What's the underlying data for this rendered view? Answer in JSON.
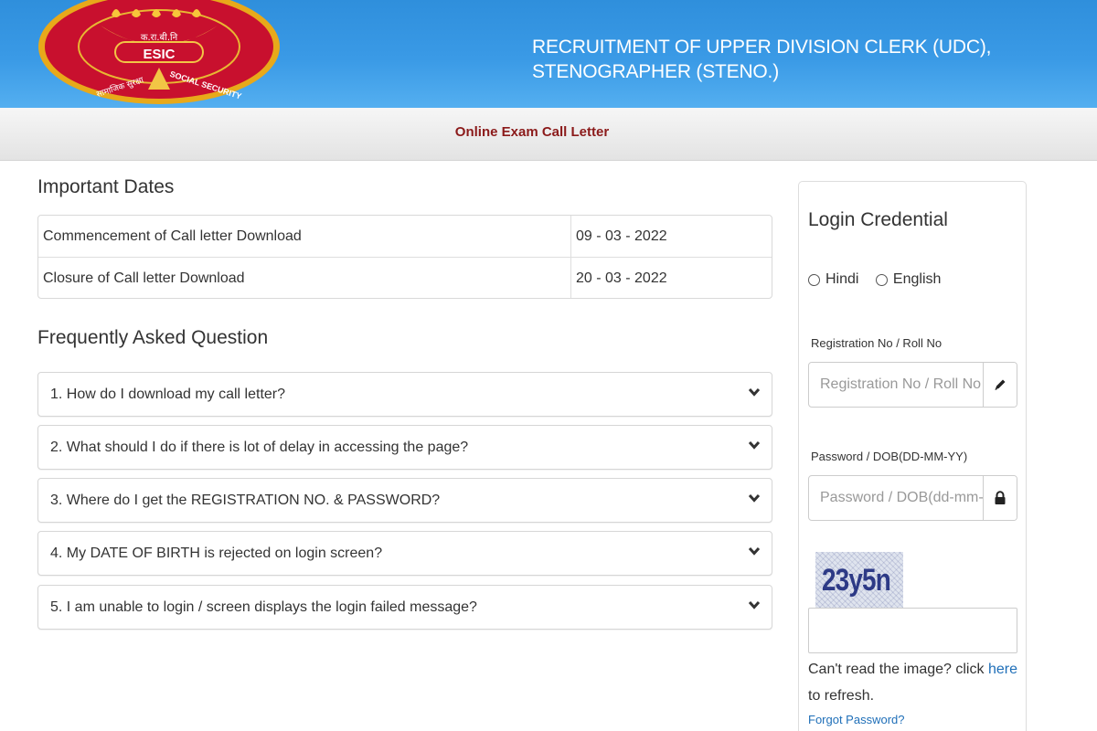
{
  "header": {
    "logo_text": "ESIC",
    "logo_devanagari": "क.रा.बी.नि",
    "logo_motto_left": "सामाजिक सुरक्षा",
    "logo_motto_right": "SOCIAL SECURITY",
    "title_line1": "RECRUITMENT OF UPPER DIVISION CLERK (UDC),",
    "title_line2": "STENOGRAPHER (STENO.)"
  },
  "subbar": {
    "title": "Online Exam Call Letter"
  },
  "important_dates": {
    "heading": "Important Dates",
    "rows": [
      {
        "label": "Commencement of Call letter Download",
        "value": "09 - 03 - 2022"
      },
      {
        "label": "Closure of Call letter Download",
        "value": "20 - 03 - 2022"
      }
    ]
  },
  "faq": {
    "heading": "Frequently Asked Question",
    "items": [
      "1. How do I download my call letter?",
      "2. What should I do if there is lot of delay in accessing the page?",
      "3. Where do I get the REGISTRATION NO. & PASSWORD?",
      "4. My DATE OF BIRTH is rejected on login screen?",
      "5. I am unable to login / screen displays the login failed message?"
    ]
  },
  "login": {
    "title": "Login Credential",
    "languages": [
      "Hindi",
      "English"
    ],
    "registration_label": "Registration No / Roll No",
    "registration_placeholder": "Registration No / Roll No",
    "password_label": "Password / DOB(DD-MM-YY)",
    "password_placeholder": "Password / DOB(dd-mm-yy)",
    "captcha_text": "23y5n",
    "captcha_value": "",
    "refresh_prefix": "Can't read the image? click ",
    "refresh_link": "here",
    "refresh_suffix": " to refresh.",
    "forgot_password": "Forgot Password?"
  },
  "colors": {
    "header_blue": "#3a9ae6",
    "subbar_title": "#8b1a1a",
    "logo_red": "#c8102e",
    "logo_gold": "#f2b01e",
    "link_blue": "#1f6fb8"
  },
  "icons": {
    "faq_toggle": "chevron-down-icon",
    "registration_addon": "pencil-icon",
    "password_addon": "lock-icon"
  }
}
